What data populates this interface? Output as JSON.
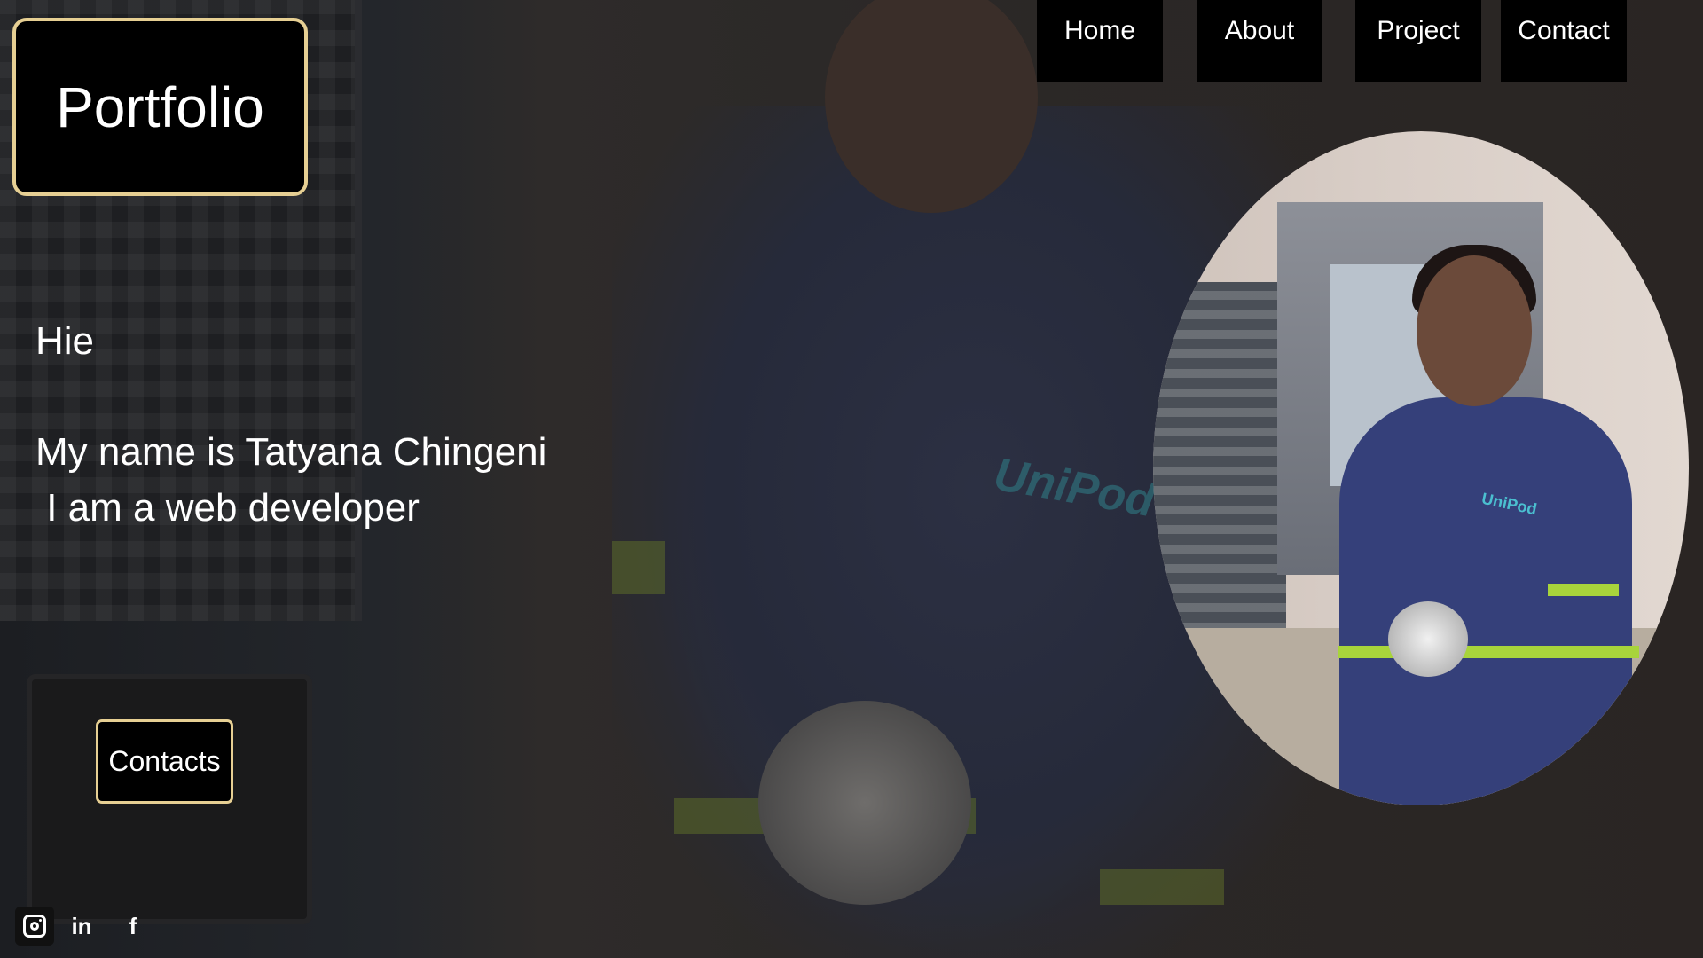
{
  "brand": {
    "logo_text": "Portfolio"
  },
  "nav": {
    "items": [
      {
        "label": "Home"
      },
      {
        "label": "About"
      },
      {
        "label": "Project"
      },
      {
        "label": "Contact"
      }
    ]
  },
  "intro": {
    "greeting": "Hie",
    "name_line": "My name is Tatyana Chingeni",
    "role_line": " I am a web developer"
  },
  "cta": {
    "contacts_label": "Contacts"
  },
  "background_photo": {
    "shirt_logo": "UniPod"
  },
  "portrait": {
    "shirt_logo": "UniPod"
  },
  "social": {
    "icons": [
      "instagram-icon",
      "linkedin-icon",
      "facebook-icon"
    ],
    "linkedin_glyph": "in",
    "facebook_glyph": "f"
  },
  "colors": {
    "accent_border": "#e6cf93",
    "panel_black": "#000000",
    "text": "#ffffff",
    "background": "#2a2523"
  }
}
